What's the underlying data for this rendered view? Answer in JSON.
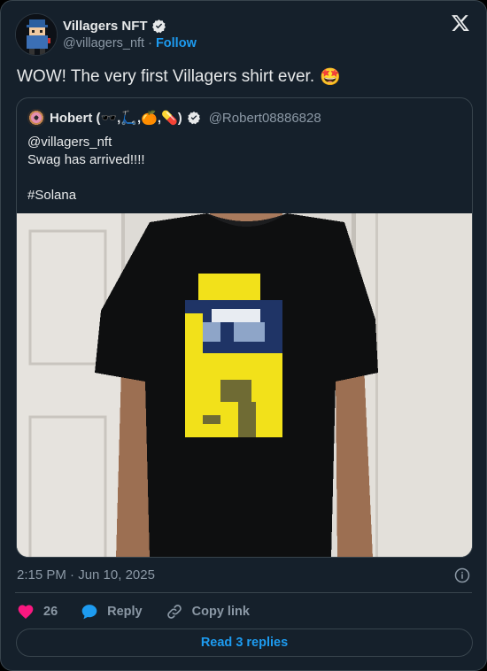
{
  "author": {
    "display_name": "Villagers NFT",
    "handle": "@villagers_nft",
    "separator": "·",
    "follow_label": "Follow",
    "verified": true
  },
  "tweet": {
    "text": "WOW! The very first Villagers shirt ever.",
    "emoji": "🤩"
  },
  "quoted_tweet": {
    "display_name": "Hobert (🕶️,🛴,🍊,💊)",
    "handle": "@Robert08886828",
    "verified": true,
    "lines": [
      "@villagers_nft",
      "Swag has arrived!!!!",
      "",
      "#Solana"
    ],
    "image_alt": "Person wearing a black t-shirt with a yellow pixel Villager character"
  },
  "timestamp": "2:15 PM · Jun 10, 2025",
  "actions": {
    "like_count": "26",
    "reply_label": "Reply",
    "copy_link_label": "Copy link"
  },
  "read_replies_label": "Read 3 replies",
  "colors": {
    "background": "#15202b",
    "border": "#38444d",
    "accent": "#1d9bf0",
    "like": "#f91880",
    "secondary_text": "#8b98a5",
    "shirt": "#0e0f10",
    "villager_yellow": "#f2e11a",
    "villager_navy": "#1f3466"
  }
}
